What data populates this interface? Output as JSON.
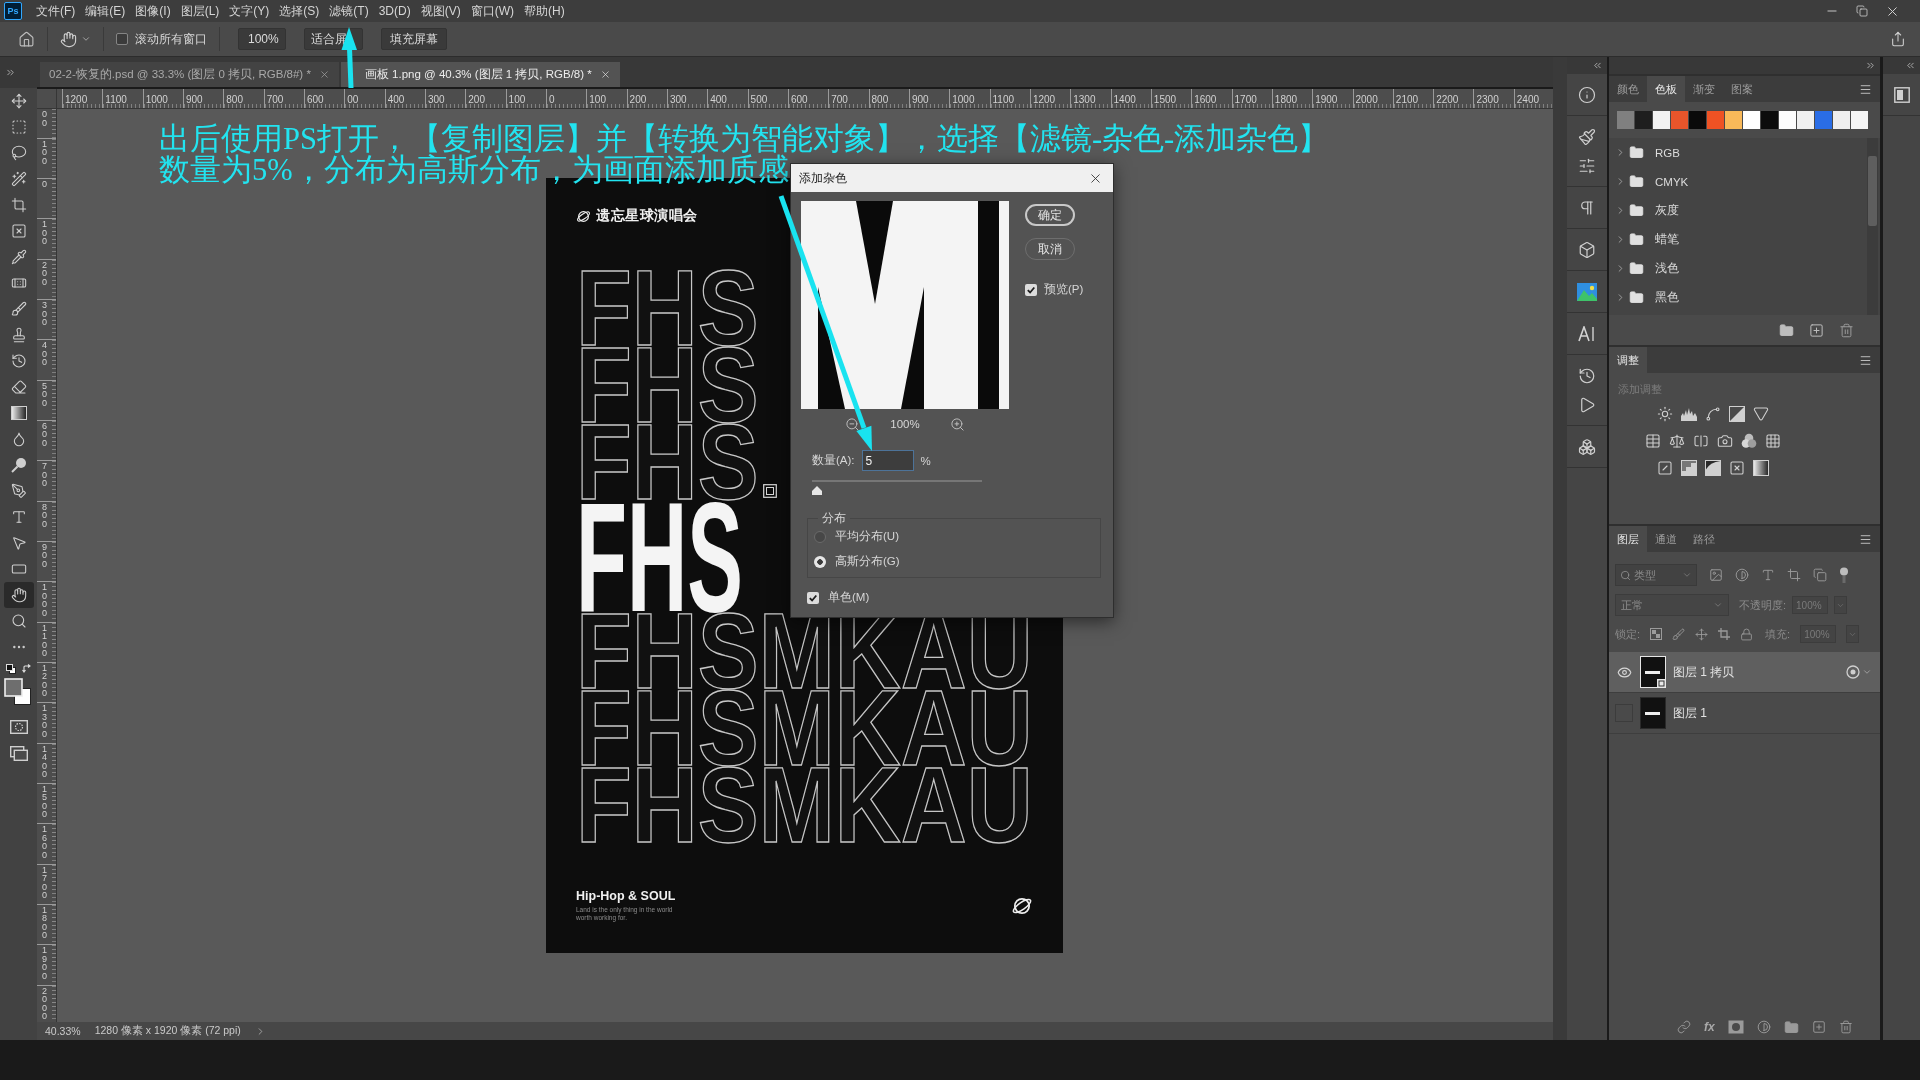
{
  "app_logo": "Ps",
  "menu_bar": [
    "文件(F)",
    "编辑(E)",
    "图像(I)",
    "图层(L)",
    "文字(Y)",
    "选择(S)",
    "滤镜(T)",
    "3D(D)",
    "视图(V)",
    "窗口(W)",
    "帮助(H)"
  ],
  "options_bar": {
    "scroll_all_windows": {
      "label": "滚动所有窗口",
      "checked": false
    },
    "zoom_button": "100%",
    "buttons": [
      "适合屏",
      "填充屏幕"
    ]
  },
  "document_tabs": [
    {
      "title": "02-2-恢复的.psd @ 33.3% (图层 0 拷贝, RGB/8#) *",
      "selected": false
    },
    {
      "title": "画板 1.png @ 40.3% (图层 1 拷贝, RGB/8) *",
      "selected": true
    }
  ],
  "toolbar": [
    {
      "kind": "move",
      "selected": false
    },
    {
      "kind": "marquee",
      "selected": false
    },
    {
      "kind": "lasso",
      "selected": false
    },
    {
      "kind": "magic-wand",
      "selected": false
    },
    {
      "kind": "crop",
      "selected": false
    },
    {
      "kind": "frame",
      "selected": false
    },
    {
      "kind": "eyedropper",
      "selected": false
    },
    {
      "kind": "healing",
      "selected": false
    },
    {
      "kind": "brush",
      "selected": false
    },
    {
      "kind": "stamp",
      "selected": false
    },
    {
      "kind": "history-brush",
      "selected": false
    },
    {
      "kind": "eraser",
      "selected": false
    },
    {
      "kind": "gradient",
      "selected": false
    },
    {
      "kind": "blur",
      "selected": false
    },
    {
      "kind": "dodge",
      "selected": false
    },
    {
      "kind": "pen",
      "selected": false
    },
    {
      "kind": "type",
      "selected": false
    },
    {
      "kind": "path-select",
      "selected": false
    },
    {
      "kind": "rectangle",
      "selected": false
    },
    {
      "kind": "hand",
      "selected": true
    },
    {
      "kind": "zoom",
      "selected": false
    },
    {
      "kind": "more",
      "selected": false
    }
  ],
  "rulers": {
    "horizontal": [
      "1200",
      "1100",
      "1000",
      "900",
      "800",
      "700",
      "600",
      "00",
      "400",
      "300",
      "200",
      "100",
      "0",
      "100",
      "200",
      "300",
      "400",
      "500",
      "600",
      "700",
      "800",
      "900",
      "1000",
      "1100",
      "1200",
      "1300",
      "1400",
      "1500",
      "1600",
      "1700",
      "1800",
      "1900",
      "2000",
      "2100",
      "2200",
      "2300",
      "2400"
    ],
    "vertical": [
      "00",
      "100",
      "0",
      "100",
      "200",
      "300",
      "400",
      "500",
      "600",
      "700",
      "800",
      "900",
      "1000",
      "1100",
      "1200",
      "1300",
      "1400",
      "1500",
      "1600",
      "1700",
      "1800",
      "1900",
      "2000"
    ]
  },
  "annotation": [
    "出后使用PS打开，【复制图层】并【转换为智能对象】，选择【滤镜-杂色-添加杂色】",
    "数量为5%，分布为高斯分布，为画面添加质感"
  ],
  "poster": {
    "logo": "遗忘星球演唱会",
    "rows": [
      {
        "text": "FHS",
        "kind": "outline"
      },
      {
        "text": "FHS",
        "kind": "outline"
      },
      {
        "text": "FHS",
        "kind": "outline"
      },
      {
        "text": "FHS",
        "kind": "solid"
      },
      {
        "text": "FHSMKAU",
        "kind": "outline"
      },
      {
        "text": "FHSMKAU",
        "kind": "outline"
      },
      {
        "text": "FHSMKAU",
        "kind": "outline"
      }
    ],
    "title": "Hip-Hop & SOUL",
    "tagline": [
      "Land is the only thing in the world",
      "worth working for."
    ]
  },
  "dialog": {
    "title": "添加杂色",
    "zoom": "100%",
    "amount": {
      "label": "数量(A):",
      "value": "5",
      "unit": "%",
      "level": 0.03
    },
    "distribution": {
      "legend": "分布",
      "options": [
        {
          "label": "平均分布(U)",
          "selected": false
        },
        {
          "label": "高斯分布(G)",
          "selected": true
        }
      ]
    },
    "monochrome": {
      "label": "单色(M)",
      "checked": true
    },
    "buttons": [
      {
        "label": "确定",
        "default": true
      },
      {
        "label": "取消",
        "default": false
      }
    ],
    "preview": {
      "label": "预览(P)",
      "checked": true
    }
  },
  "status_bar": {
    "zoom": "40.33%",
    "document_size": "1280 像素 x 1920 像素 (72 ppi)"
  },
  "swatches_panel": {
    "tabs": [
      {
        "label": "颜色",
        "selected": false
      },
      {
        "label": "色板",
        "selected": true
      },
      {
        "label": "渐变",
        "selected": false
      },
      {
        "label": "图案",
        "selected": false
      }
    ],
    "recent": [
      {
        "color": "#808080"
      },
      {
        "color": "#1e1e1e"
      },
      {
        "color": "#f2f2f2"
      },
      {
        "color": "#e8552b"
      },
      {
        "color": "#0a0a0a"
      },
      {
        "color": "#ee5224"
      },
      {
        "color": "#f9b959"
      },
      {
        "color": "#ffffff"
      },
      {
        "color": "#0c0c0c"
      },
      {
        "color": "#fdfdfd"
      },
      {
        "color": "#f0f0f0"
      },
      {
        "color": "#2a6de6"
      },
      {
        "color": "#eeeeee"
      },
      {
        "color": "#f5f5f5"
      }
    ],
    "groups": [
      {
        "name": "RGB",
        "expanded": false
      },
      {
        "name": "CMYK",
        "expanded": false
      },
      {
        "name": "灰度",
        "expanded": false
      },
      {
        "name": "蜡笔",
        "expanded": false
      },
      {
        "name": "浅色",
        "expanded": false
      },
      {
        "name": "黑色",
        "expanded": false
      }
    ]
  },
  "adjustments_panel": {
    "tabs": [
      {
        "label": "调整",
        "selected": true
      }
    ],
    "hint": "添加调整"
  },
  "layers_panel": {
    "tabs": [
      {
        "label": "图层",
        "selected": true
      },
      {
        "label": "通道",
        "selected": false
      },
      {
        "label": "路径",
        "selected": false
      }
    ],
    "filter_kind": "类型",
    "blend_mode": "正常",
    "opacity": {
      "label": "不透明度:",
      "value": "100%",
      "disabled": true
    },
    "lock_label": "锁定:",
    "fill": {
      "label": "填充:",
      "value": "100%",
      "disabled": true
    },
    "layers": [
      {
        "name": "图层 1 拷贝",
        "visible": true,
        "selected": true,
        "smart_object": true
      },
      {
        "name": "图层 1",
        "visible": false,
        "selected": false,
        "smart_object": false
      }
    ],
    "effects_button": "fx"
  }
}
